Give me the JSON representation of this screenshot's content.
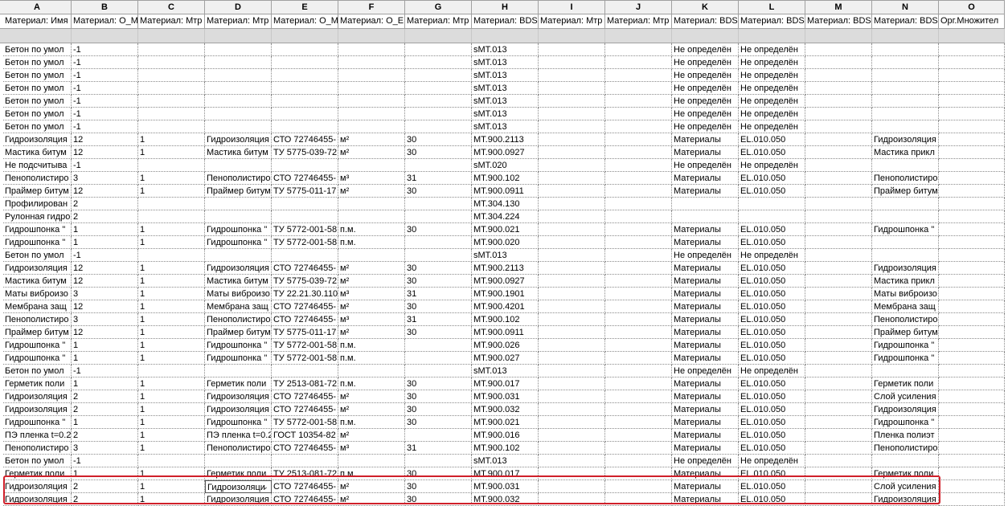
{
  "columns": [
    "A",
    "B",
    "C",
    "D",
    "E",
    "F",
    "G",
    "H",
    "I",
    "J",
    "K",
    "L",
    "M",
    "N",
    "O"
  ],
  "headers": [
    "Материал: Имя",
    "Материал: О_М",
    "Материал: Мтр",
    "Материал: Мтр",
    "Материал: О_М",
    "Материал: О_Е",
    "Материал: Мтр",
    "Материал: BDS",
    "Материал: Мтр",
    "Материал: Мтр",
    "Материал: BDS",
    "Материал: BDS",
    "Материал: BDS",
    "Материал: BDS",
    "Орг.Множител"
  ],
  "rows": [
    [
      "Бетон по умол",
      "-1",
      "",
      "",
      "",
      "",
      "",
      "sMT.013",
      "",
      "",
      "Не определён",
      "Не определён",
      "",
      "",
      ""
    ],
    [
      "Бетон по умол",
      "-1",
      "",
      "",
      "",
      "",
      "",
      "sMT.013",
      "",
      "",
      "Не определён",
      "Не определён",
      "",
      "",
      ""
    ],
    [
      "Бетон по умол",
      "-1",
      "",
      "",
      "",
      "",
      "",
      "sMT.013",
      "",
      "",
      "Не определён",
      "Не определён",
      "",
      "",
      ""
    ],
    [
      "Бетон по умол",
      "-1",
      "",
      "",
      "",
      "",
      "",
      "sMT.013",
      "",
      "",
      "Не определён",
      "Не определён",
      "",
      "",
      ""
    ],
    [
      "Бетон по умол",
      "-1",
      "",
      "",
      "",
      "",
      "",
      "sMT.013",
      "",
      "",
      "Не определён",
      "Не определён",
      "",
      "",
      ""
    ],
    [
      "Бетон по умол",
      "-1",
      "",
      "",
      "",
      "",
      "",
      "sMT.013",
      "",
      "",
      "Не определён",
      "Не определён",
      "",
      "",
      ""
    ],
    [
      "Бетон по умол",
      "-1",
      "",
      "",
      "",
      "",
      "",
      "sMT.013",
      "",
      "",
      "Не определён",
      "Не определён",
      "",
      "",
      ""
    ],
    [
      "Гидроизоляция",
      "12",
      "1",
      "Гидроизоляция",
      "СТО 72746455-",
      "м²",
      "30",
      "MT.900.2113",
      "",
      "",
      "Материалы",
      "EL.010.050",
      "",
      "Гидроизоляция",
      ""
    ],
    [
      "Мастика битум",
      "12",
      "1",
      "Мастика битум",
      "ТУ 5775-039-72",
      "м²",
      "30",
      "MT.900.0927",
      "",
      "",
      "Материалы",
      "EL.010.050",
      "",
      "Мастика прикл",
      ""
    ],
    [
      "Не подсчитыва",
      "-1",
      "",
      "",
      "",
      "",
      "",
      "sMT.020",
      "",
      "",
      "Не определён",
      "Не определён",
      "",
      "",
      ""
    ],
    [
      "Пенополистиро",
      "3",
      "1",
      "Пенополистиро",
      "СТО 72746455-",
      "м³",
      "31",
      "MT.900.102",
      "",
      "",
      "Материалы",
      "EL.010.050",
      "",
      "Пенополистиро",
      ""
    ],
    [
      "Праймер битум",
      "12",
      "1",
      "Праймер битум",
      "ТУ 5775-011-17",
      "м²",
      "30",
      "MT.900.0911",
      "",
      "",
      "Материалы",
      "EL.010.050",
      "",
      "Праймер битум",
      ""
    ],
    [
      "Профилирован",
      "2",
      "",
      "",
      "",
      "",
      "",
      "MT.304.130",
      "",
      "",
      "",
      "",
      "",
      "",
      ""
    ],
    [
      "Рулонная гидро",
      "2",
      "",
      "",
      "",
      "",
      "",
      "MT.304.224",
      "",
      "",
      "",
      "",
      "",
      "",
      ""
    ],
    [
      "Гидрошпонка \"",
      "1",
      "1",
      "Гидрошпонка \"",
      "ТУ 5772-001-58",
      "п.м.",
      "30",
      "MT.900.021",
      "",
      "",
      "Материалы",
      "EL.010.050",
      "",
      "Гидрошпонка \"",
      ""
    ],
    [
      "Гидрошпонка \"",
      "1",
      "1",
      "Гидрошпонка \"",
      "ТУ 5772-001-58",
      "п.м.",
      "",
      "MT.900.020",
      "",
      "",
      "Материалы",
      "EL.010.050",
      "",
      "",
      ""
    ],
    [
      "Бетон по умол",
      "-1",
      "",
      "",
      "",
      "",
      "",
      "sMT.013",
      "",
      "",
      "Не определён",
      "Не определён",
      "",
      "",
      ""
    ],
    [
      "Гидроизоляция",
      "12",
      "1",
      "Гидроизоляция",
      "СТО 72746455-",
      "м²",
      "30",
      "MT.900.2113",
      "",
      "",
      "Материалы",
      "EL.010.050",
      "",
      "Гидроизоляция",
      ""
    ],
    [
      "Мастика битум",
      "12",
      "1",
      "Мастика битум",
      "ТУ 5775-039-72",
      "м²",
      "30",
      "MT.900.0927",
      "",
      "",
      "Материалы",
      "EL.010.050",
      "",
      "Мастика прикл",
      ""
    ],
    [
      "Маты виброизо",
      "3",
      "1",
      "Маты виброизо",
      "ТУ 22.21.30.110",
      "м³",
      "31",
      "MT.900.1901",
      "",
      "",
      "Материалы",
      "EL.010.050",
      "",
      "Маты виброизо",
      ""
    ],
    [
      "Мембрана защ",
      "12",
      "1",
      "Мембрана защ",
      "СТО 72746455-",
      "м²",
      "30",
      "MT.900.4201",
      "",
      "",
      "Материалы",
      "EL.010.050",
      "",
      "Мембрана защ",
      ""
    ],
    [
      "Пенополистиро",
      "3",
      "1",
      "Пенополистиро",
      "СТО 72746455-",
      "м³",
      "31",
      "MT.900.102",
      "",
      "",
      "Материалы",
      "EL.010.050",
      "",
      "Пенополистиро",
      ""
    ],
    [
      "Праймер битум",
      "12",
      "1",
      "Праймер битум",
      "ТУ 5775-011-17",
      "м²",
      "30",
      "MT.900.0911",
      "",
      "",
      "Материалы",
      "EL.010.050",
      "",
      "Праймер битум",
      ""
    ],
    [
      "Гидрошпонка \"",
      "1",
      "1",
      "Гидрошпонка \"",
      "ТУ 5772-001-58",
      "п.м.",
      "",
      "MT.900.026",
      "",
      "",
      "Материалы",
      "EL.010.050",
      "",
      "Гидрошпонка \"",
      ""
    ],
    [
      "Гидрошпонка \"",
      "1",
      "1",
      "Гидрошпонка \"",
      "ТУ 5772-001-58",
      "п.м.",
      "",
      "MT.900.027",
      "",
      "",
      "Материалы",
      "EL.010.050",
      "",
      "Гидрошпонка \"",
      ""
    ],
    [
      "Бетон по умол",
      "-1",
      "",
      "",
      "",
      "",
      "",
      "sMT.013",
      "",
      "",
      "Не определён",
      "Не определён",
      "",
      "",
      ""
    ],
    [
      "Герметик поли",
      "1",
      "1",
      "Герметик поли",
      "ТУ 2513-081-72",
      "п.м.",
      "30",
      "MT.900.017",
      "",
      "",
      "Материалы",
      "EL.010.050",
      "",
      "Герметик поли",
      ""
    ],
    [
      "Гидроизоляция",
      "2",
      "1",
      "Гидроизоляция",
      "СТО 72746455-",
      "м²",
      "30",
      "MT.900.031",
      "",
      "",
      "Материалы",
      "EL.010.050",
      "",
      "Слой усиления",
      ""
    ],
    [
      "Гидроизоляция",
      "2",
      "1",
      "Гидроизоляция",
      "СТО 72746455-",
      "м²",
      "30",
      "MT.900.032",
      "",
      "",
      "Материалы",
      "EL.010.050",
      "",
      "Гидроизоляция",
      ""
    ],
    [
      "Гидрошпонка \"",
      "1",
      "1",
      "Гидрошпонка \"",
      "ТУ 5772-001-58",
      "п.м.",
      "30",
      "MT.900.021",
      "",
      "",
      "Материалы",
      "EL.010.050",
      "",
      "Гидрошпонка \"",
      ""
    ],
    [
      "ПЭ пленка t=0.2",
      "2",
      "1",
      "ПЭ пленка t=0.2",
      "ГОСТ 10354-82",
      "м²",
      "",
      "MT.900.016",
      "",
      "",
      "Материалы",
      "EL.010.050",
      "",
      "Пленка полиэт",
      ""
    ],
    [
      "Пенополистиро",
      "3",
      "1",
      "Пенополистиро",
      "СТО 72746455-",
      "м³",
      "31",
      "MT.900.102",
      "",
      "",
      "Материалы",
      "EL.010.050",
      "",
      "Пенополистиро",
      ""
    ],
    [
      "Бетон по умол",
      "-1",
      "",
      "",
      "",
      "",
      "",
      "sMT.013",
      "",
      "",
      "Не определён",
      "Не определён",
      "",
      "",
      ""
    ],
    [
      "Герметик поли",
      "1",
      "1",
      "Герметик поли",
      "ТУ 2513-081-72",
      "п.м.",
      "30",
      "MT.900.017",
      "",
      "",
      "Материалы",
      "EL.010.050",
      "",
      "Герметик поли",
      ""
    ],
    [
      "Гидроизоляция",
      "2",
      "1",
      "Гидроизоляци",
      "СТО 72746455-",
      "м²",
      "30",
      "MT.900.031",
      "",
      "",
      "Материалы",
      "EL.010.050",
      "",
      "Слой усиления",
      ""
    ],
    [
      "Гидроизоляция",
      "2",
      "1",
      "Гидроизоляция",
      "СТО 72746455-",
      "м²",
      "30",
      "MT.900.032",
      "",
      "",
      "Материалы",
      "EL.010.050",
      "",
      "Гидроизоляция",
      ""
    ]
  ],
  "active_cell": {
    "row": 34,
    "col": 3
  },
  "highlight_color": "#d0202a",
  "icons": {
    "dropdown": "chevron-down-icon"
  }
}
